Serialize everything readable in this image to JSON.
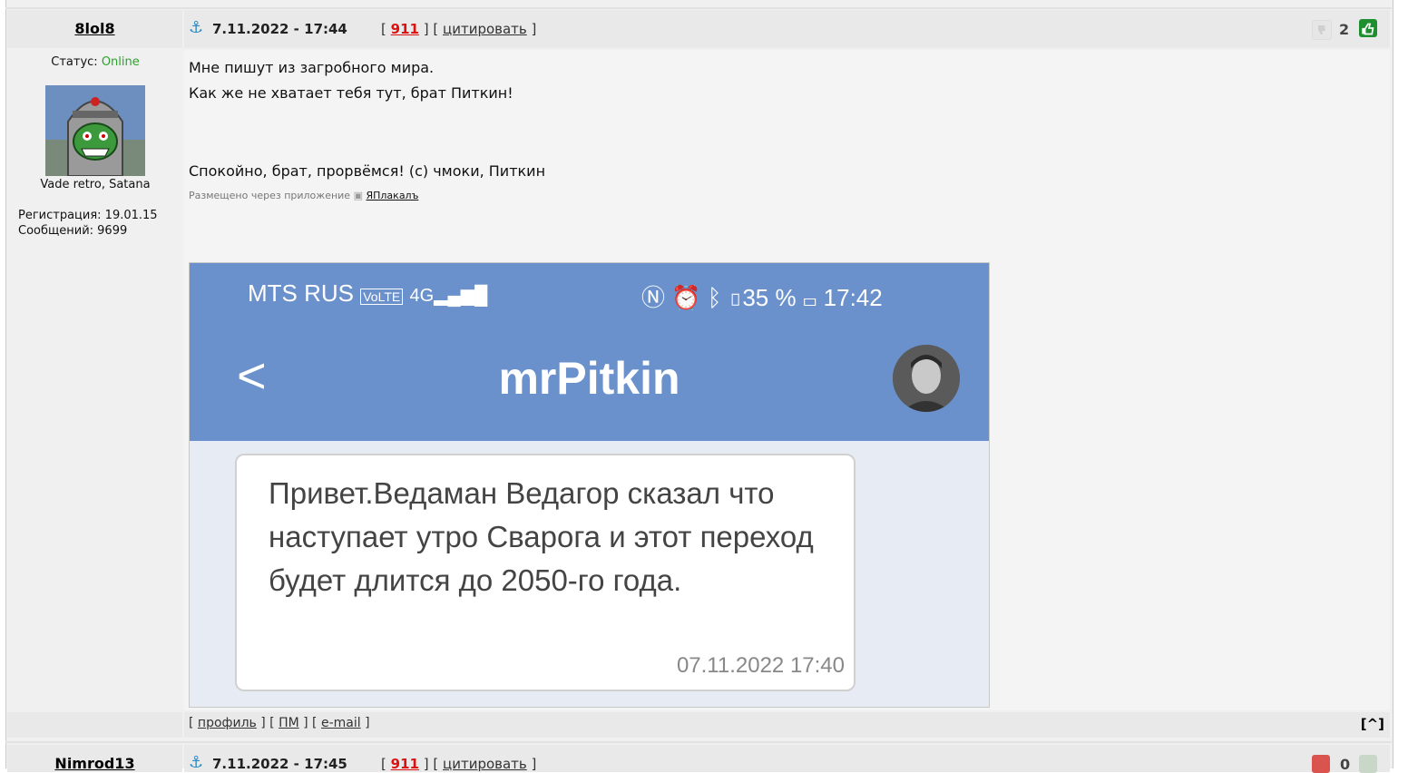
{
  "post1": {
    "username": "8lol8",
    "date": "7.11.2022 - 17:44",
    "bracket_open": "[",
    "bracket_mid": "] [",
    "bracket_close": "]",
    "post_number": "911",
    "quote_label": "цитировать",
    "rating": "2",
    "status_label": "Статус:",
    "status_value": "Online",
    "motto": "Vade retro, Satana",
    "registration": "Регистрация: 19.01.15",
    "messages": "Сообщений: 9699",
    "lines": [
      "Мне пишут из загробного мира.",
      "Как же не хватает тебя тут, брат Питкин!",
      "Спокойно, брат, прорвёмся! (с) чмоки, Питкин"
    ],
    "via_text": "Размещено через приложение",
    "via_app": "ЯПлакалъ",
    "footer": {
      "profile": "профиль",
      "pm": "ПМ",
      "email": "e-mail",
      "to_top": "[^]"
    },
    "image": {
      "carrier": "MTS RUS",
      "status_right": "35 %",
      "clock": "17:42",
      "contact": "mrPitkin",
      "back_glyph": "<",
      "message": "Привет.Ведаман Ведагор сказал что наступает утро Сварога и этот переход будет длится до 2050-го года.",
      "timestamp": "07.11.2022 17:40"
    }
  },
  "post2": {
    "username": "Nimrod13",
    "date": "7.11.2022 - 17:45",
    "post_number": "911",
    "quote_label": "цитировать",
    "rating": "0"
  },
  "colors": {
    "online": "#2aa32a",
    "post_number": "#dd1111",
    "like": "#1e8f2e",
    "dislike": "#d9534f",
    "phone_header": "#6b91cc"
  }
}
